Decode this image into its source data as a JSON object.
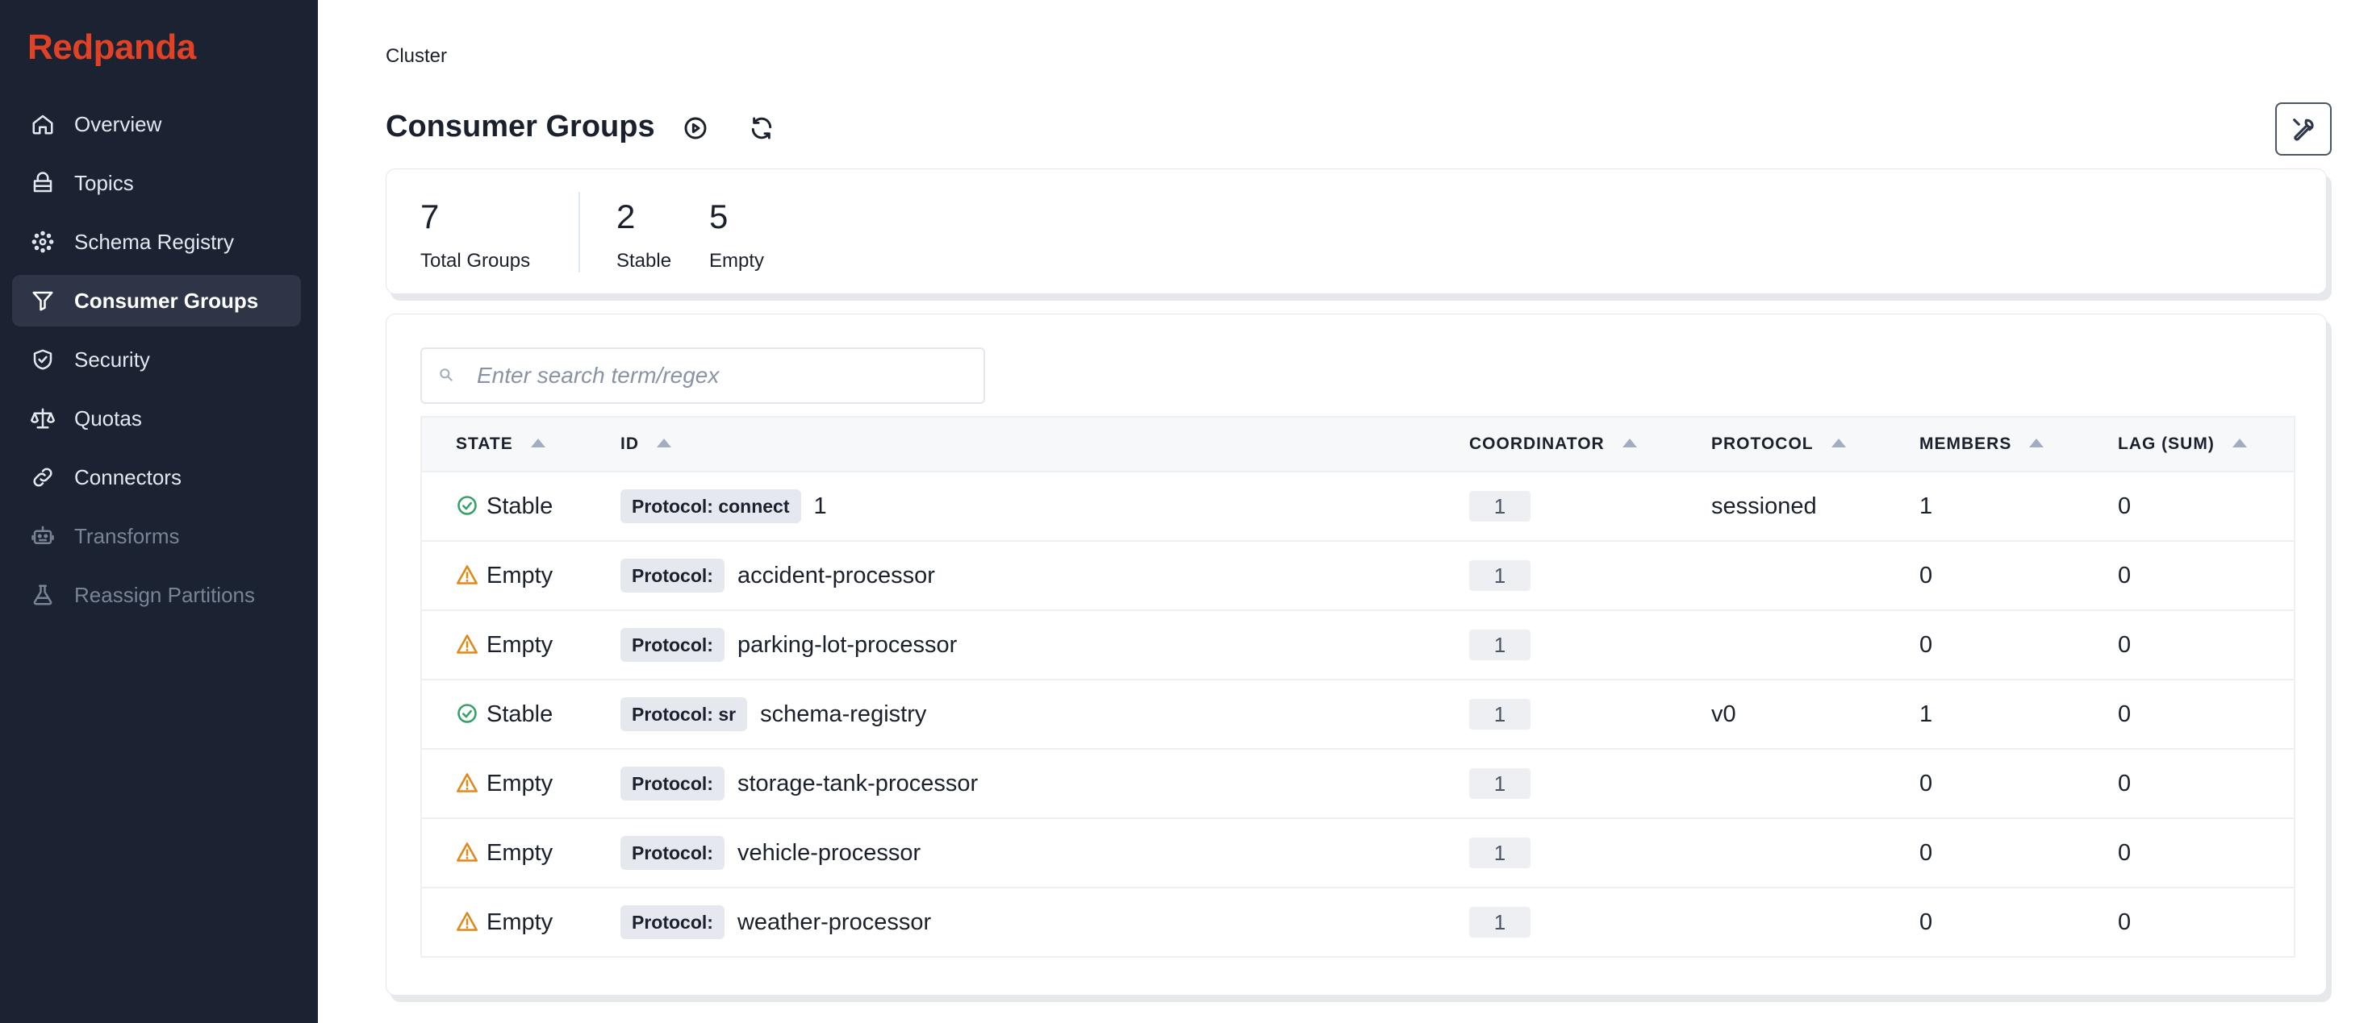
{
  "brand": "Redpanda",
  "sidebar": {
    "items": [
      {
        "label": "Overview",
        "icon": "home-icon",
        "state": "normal"
      },
      {
        "label": "Topics",
        "icon": "topics-icon",
        "state": "normal"
      },
      {
        "label": "Schema Registry",
        "icon": "schema-registry-icon",
        "state": "normal"
      },
      {
        "label": "Consumer Groups",
        "icon": "funnel-icon",
        "state": "active"
      },
      {
        "label": "Security",
        "icon": "shield-icon",
        "state": "normal"
      },
      {
        "label": "Quotas",
        "icon": "scale-icon",
        "state": "normal"
      },
      {
        "label": "Connectors",
        "icon": "link-icon",
        "state": "normal"
      },
      {
        "label": "Transforms",
        "icon": "robot-icon",
        "state": "disabled"
      },
      {
        "label": "Reassign Partitions",
        "icon": "beaker-icon",
        "state": "disabled"
      }
    ]
  },
  "breadcrumb": "Cluster",
  "page": {
    "title": "Consumer Groups",
    "buttons": [
      "play-circle-icon",
      "refresh-icon",
      "wrench-icon"
    ]
  },
  "stats": {
    "total": {
      "value": "7",
      "label": "Total Groups"
    },
    "stable": {
      "value": "2",
      "label": "Stable"
    },
    "empty": {
      "value": "5",
      "label": "Empty"
    }
  },
  "search": {
    "placeholder": "Enter search term/regex",
    "value": ""
  },
  "table": {
    "columns": [
      "STATE",
      "ID",
      "COORDINATOR",
      "PROTOCOL",
      "MEMBERS",
      "LAG (SUM)"
    ],
    "rows": [
      {
        "state": "Stable",
        "protocol_tag": "Protocol: connect",
        "id": "1",
        "coordinator": "1",
        "protocol": "sessioned",
        "members": "1",
        "lag": "0"
      },
      {
        "state": "Empty",
        "protocol_tag": "Protocol:",
        "id": "accident-processor",
        "coordinator": "1",
        "protocol": "",
        "members": "0",
        "lag": "0"
      },
      {
        "state": "Empty",
        "protocol_tag": "Protocol:",
        "id": "parking-lot-processor",
        "coordinator": "1",
        "protocol": "",
        "members": "0",
        "lag": "0"
      },
      {
        "state": "Stable",
        "protocol_tag": "Protocol: sr",
        "id": "schema-registry",
        "coordinator": "1",
        "protocol": "v0",
        "members": "1",
        "lag": "0"
      },
      {
        "state": "Empty",
        "protocol_tag": "Protocol:",
        "id": "storage-tank-processor",
        "coordinator": "1",
        "protocol": "",
        "members": "0",
        "lag": "0"
      },
      {
        "state": "Empty",
        "protocol_tag": "Protocol:",
        "id": "vehicle-processor",
        "coordinator": "1",
        "protocol": "",
        "members": "0",
        "lag": "0"
      },
      {
        "state": "Empty",
        "protocol_tag": "Protocol:",
        "id": "weather-processor",
        "coordinator": "1",
        "protocol": "",
        "members": "0",
        "lag": "0"
      }
    ]
  },
  "colors": {
    "brand": "#e14226",
    "sidebar_bg": "#1b2231",
    "stable": "#38a169",
    "empty": "#dd8a1b"
  }
}
